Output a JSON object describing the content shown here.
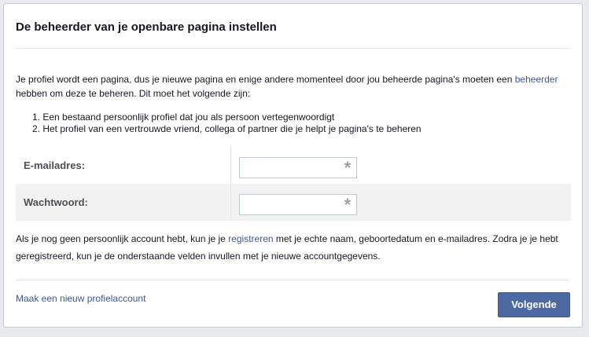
{
  "dialog": {
    "title": "De beheerder van je openbare pagina instellen",
    "intro_part1": "Je profiel wordt een pagina, dus je nieuwe pagina en enige andere momenteel door jou beheerde pagina's moeten een ",
    "intro_link": "beheerder",
    "intro_part2": " hebben om deze te beheren. Dit moet het volgende zijn:",
    "requirements": [
      "1. Een bestaand persoonlijk profiel dat jou als persoon vertegenwoordigt",
      "2. Het profiel van een vertrouwde vriend, collega of partner die je helpt je pagina's te beheren"
    ]
  },
  "form": {
    "email_label": "E-mailadres:",
    "email_value": "",
    "password_label": "Wachtwoord:",
    "password_value": "",
    "required_icon": "asterisk-icon"
  },
  "outro": {
    "part1": "Als je nog geen persoonlijk account hebt, kun je je ",
    "link": "registreren",
    "part2": " met je echte naam, geboortedatum en e-mailadres. Zodra je je hebt geregistreerd, kun je de onderstaande velden invullen met je nieuwe accountgegevens."
  },
  "footer": {
    "new_profile_link": "Maak een nieuw profielaccount",
    "next_button": "Volgende"
  },
  "colors": {
    "link": "#3b5998",
    "button": "#4e69a2",
    "row_alt": "#f2f2f2"
  }
}
